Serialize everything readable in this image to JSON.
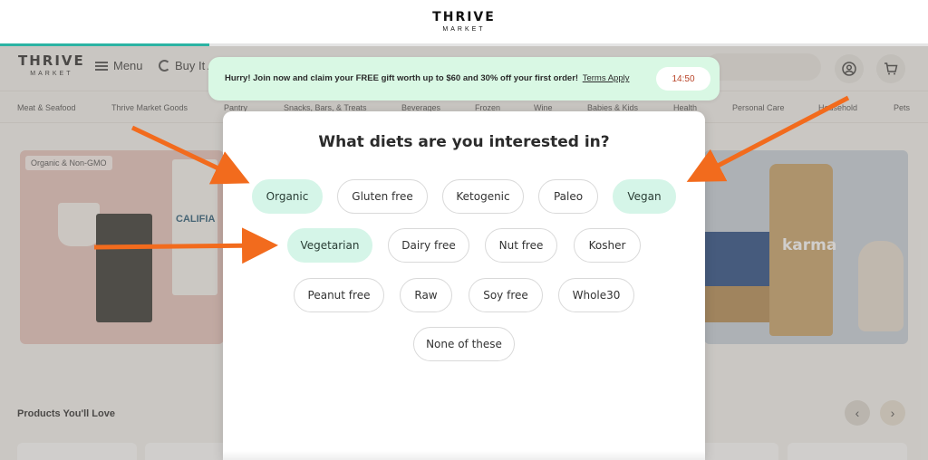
{
  "topbar": {
    "logo_line1": "THRIVE",
    "logo_line2": "MARKET",
    "progress_fraction": 0.226
  },
  "header": {
    "logo_line1": "THRIVE",
    "logo_line2": "MARKET",
    "menu_label": "Menu",
    "buy_label": "Buy It A",
    "account_icon": "user-icon",
    "cart_icon": "cart-icon"
  },
  "categories": [
    "Meat & Seafood",
    "Thrive Market Goods",
    "Pantry",
    "Snacks, Bars, & Treats",
    "Beverages",
    "Frozen",
    "Wine",
    "Babies & Kids",
    "Health",
    "Personal Care",
    "Household",
    "Pets"
  ],
  "hero": {
    "left_tag": "Organic & Non-GMO",
    "left_carton_text": "CALIFIA",
    "right_pouch_text": "karma"
  },
  "products": {
    "title": "Products You'll Love",
    "prev_icon": "chevron-left-icon",
    "next_icon": "chevron-right-icon"
  },
  "promo": {
    "message": "Hurry! Join now and claim your FREE gift worth up to $60 and 30% off your first order!",
    "terms": "Terms Apply",
    "timer": "14:50"
  },
  "modal": {
    "question": "What diets are you interested in?",
    "options": [
      {
        "label": "Organic",
        "selected": true
      },
      {
        "label": "Gluten free",
        "selected": false
      },
      {
        "label": "Ketogenic",
        "selected": false
      },
      {
        "label": "Paleo",
        "selected": false
      },
      {
        "label": "Vegan",
        "selected": true
      },
      {
        "label": "Vegetarian",
        "selected": true
      },
      {
        "label": "Dairy free",
        "selected": false
      },
      {
        "label": "Nut free",
        "selected": false
      },
      {
        "label": "Kosher",
        "selected": false
      },
      {
        "label": "Peanut free",
        "selected": false
      },
      {
        "label": "Raw",
        "selected": false
      },
      {
        "label": "Soy free",
        "selected": false
      },
      {
        "label": "Whole30",
        "selected": false
      },
      {
        "label": "None of these",
        "selected": false
      }
    ]
  },
  "colors": {
    "accent": "#2bb3a3",
    "selected_pill": "#d5f5e8",
    "promo_bg": "#d9f8e4",
    "arrow": "#f26b1d",
    "timer_text": "#b9452a"
  }
}
